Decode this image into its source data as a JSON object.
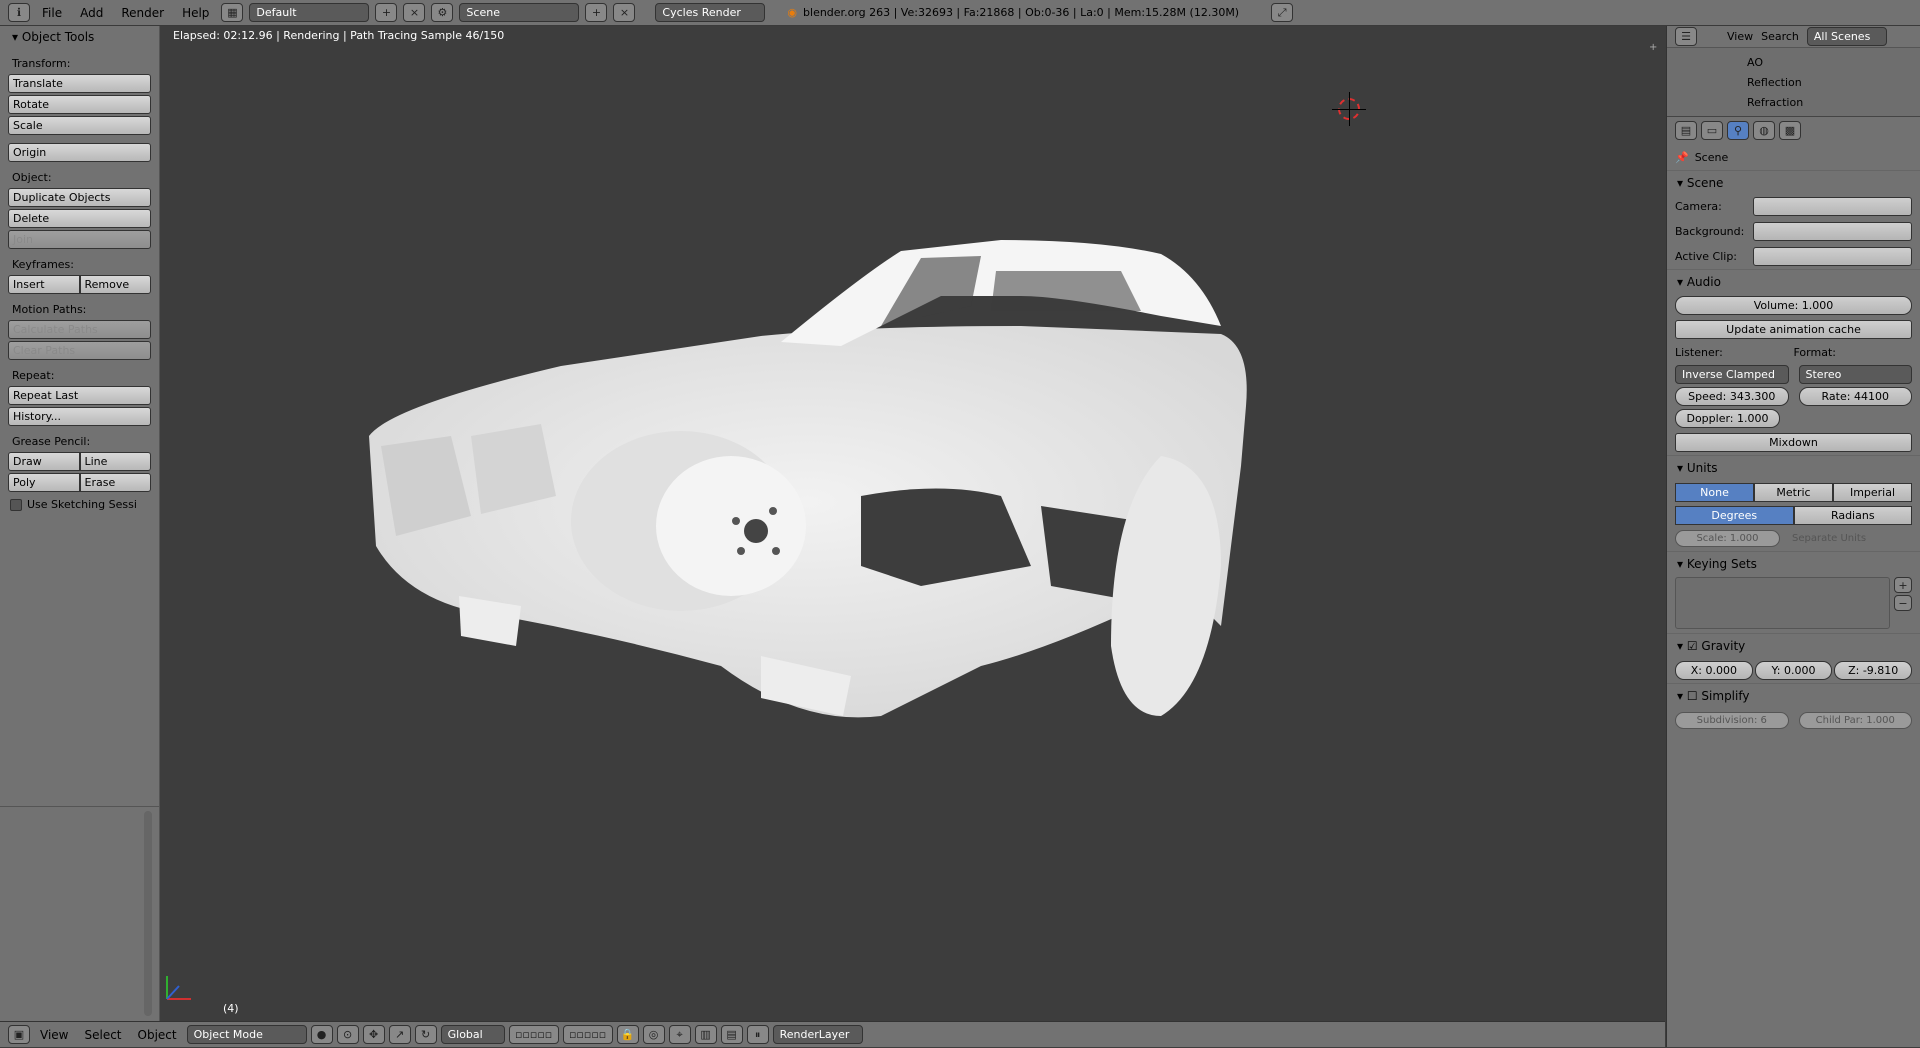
{
  "top_menu": {
    "items": [
      "File",
      "Add",
      "Render",
      "Help"
    ],
    "screen_layout": "Default",
    "scene": "Scene",
    "render_engine": "Cycles Render",
    "stats": "blender.org 263 | Ve:32693 | Fa:21868 | Ob:0-36 | La:0 | Mem:15.28M (12.30M)"
  },
  "left_panel": {
    "title": "Object Tools",
    "transform_label": "Transform:",
    "translate": "Translate",
    "rotate": "Rotate",
    "scale": "Scale",
    "origin": "Origin",
    "object_label": "Object:",
    "duplicate": "Duplicate Objects",
    "delete": "Delete",
    "join": "Join",
    "keyframes_label": "Keyframes:",
    "insert": "Insert",
    "remove": "Remove",
    "motion_label": "Motion Paths:",
    "calc_paths": "Calculate Paths",
    "clear_paths": "Clear Paths",
    "repeat_label": "Repeat:",
    "repeat_last": "Repeat Last",
    "history": "History...",
    "grease_label": "Grease Pencil:",
    "draw": "Draw",
    "line": "Line",
    "poly": "Poly",
    "erase": "Erase",
    "sketching": "Use Sketching Sessi"
  },
  "viewport": {
    "status": "Elapsed: 02:12.96 | Rendering | Path Tracing Sample 46/150",
    "frame": "(4)"
  },
  "bottom_bar": {
    "view": "View",
    "select": "Select",
    "object": "Object",
    "mode": "Object Mode",
    "orientation": "Global",
    "render_layer": "RenderLayer"
  },
  "outliner": {
    "view": "View",
    "search": "Search",
    "filter": "All Scenes",
    "items": [
      "AO",
      "Reflection",
      "Refraction"
    ]
  },
  "properties": {
    "breadcrumb": "Scene",
    "scene_section": "Scene",
    "camera_label": "Camera:",
    "background_label": "Background:",
    "clip_label": "Active Clip:",
    "audio_section": "Audio",
    "volume": "Volume: 1.000",
    "update_cache": "Update animation cache",
    "listener_label": "Listener:",
    "format_label": "Format:",
    "listener": "Inverse Clamped",
    "format": "Stereo",
    "speed": "Speed: 343.300",
    "rate": "Rate: 44100",
    "doppler": "Doppler: 1.000",
    "mixdown": "Mixdown",
    "units_section": "Units",
    "unit_none": "None",
    "unit_metric": "Metric",
    "unit_imperial": "Imperial",
    "degrees": "Degrees",
    "radians": "Radians",
    "unit_scale": "Scale: 1.000",
    "separate_units": "Separate Units",
    "keying_section": "Keying Sets",
    "gravity_section": "Gravity",
    "gx": "X: 0.000",
    "gy": "Y: 0.000",
    "gz": "Z: -9.810",
    "simplify_section": "Simplify",
    "subdivision": "Subdivision: 6",
    "child_par": "Child Par: 1.000"
  }
}
